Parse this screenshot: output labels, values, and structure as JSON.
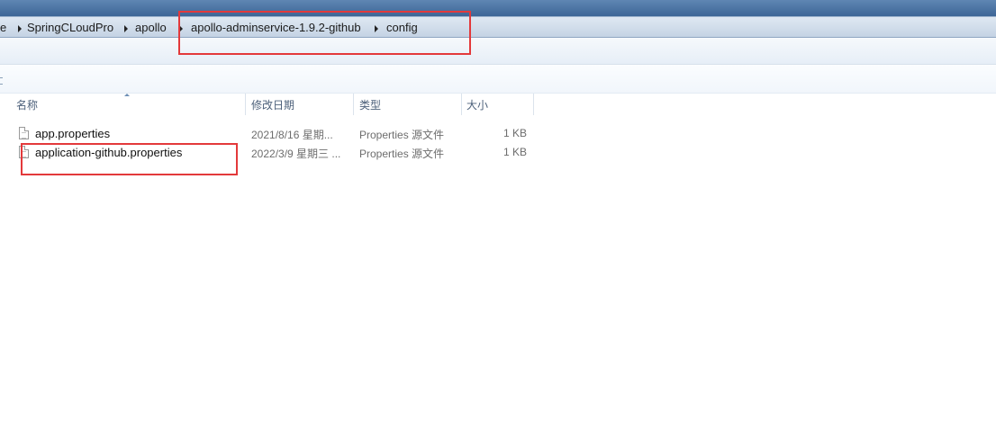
{
  "address_bar": {
    "crumbs": [
      "e",
      "SpringCLoudPro",
      "apollo",
      "apollo-adminservice-1.9.2-github",
      "config"
    ]
  },
  "columns": {
    "name": "名称",
    "date": "修改日期",
    "type": "类型",
    "size": "大小"
  },
  "files": [
    {
      "name": "app.properties",
      "date": "2021/8/16 星期...",
      "type": "Properties 源文件",
      "size": "1 KB"
    },
    {
      "name": "application-github.properties",
      "date": "2022/3/9 星期三 ...",
      "type": "Properties 源文件",
      "size": "1 KB"
    }
  ],
  "icons": {
    "file": "file-icon",
    "separator": "chevron-right-icon",
    "sort": "sort-up-icon"
  },
  "colors": {
    "annotation": "#e3393b",
    "title_band": "#3d6696",
    "address_bar": "#c4d3e4",
    "header_text": "#4c607a"
  }
}
